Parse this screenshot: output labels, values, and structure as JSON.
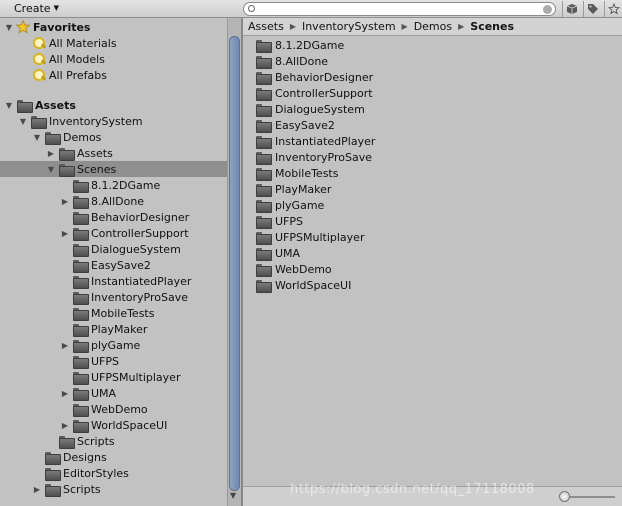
{
  "toolbar": {
    "create_label": "Create",
    "search_value": "",
    "icons": [
      "filter-by-type-icon",
      "filter-by-label-icon",
      "favorite-star-icon"
    ]
  },
  "favorites": {
    "label": "Favorites",
    "items": [
      {
        "label": "All Materials"
      },
      {
        "label": "All Models"
      },
      {
        "label": "All Prefabs"
      }
    ]
  },
  "tree": {
    "assets_label": "Assets",
    "rows": [
      {
        "label": "InventorySystem",
        "depth": 1,
        "arrow": "open"
      },
      {
        "label": "Demos",
        "depth": 2,
        "arrow": "open"
      },
      {
        "label": "Assets",
        "depth": 3,
        "arrow": "closed"
      },
      {
        "label": "Scenes",
        "depth": 3,
        "arrow": "open",
        "selected": true
      },
      {
        "label": "8.1.2DGame",
        "depth": 4,
        "arrow": "none"
      },
      {
        "label": "8.AllDone",
        "depth": 4,
        "arrow": "closed"
      },
      {
        "label": "BehaviorDesigner",
        "depth": 4,
        "arrow": "none"
      },
      {
        "label": "ControllerSupport",
        "depth": 4,
        "arrow": "closed"
      },
      {
        "label": "DialogueSystem",
        "depth": 4,
        "arrow": "none"
      },
      {
        "label": "EasySave2",
        "depth": 4,
        "arrow": "none"
      },
      {
        "label": "InstantiatedPlayer",
        "depth": 4,
        "arrow": "none"
      },
      {
        "label": "InventoryProSave",
        "depth": 4,
        "arrow": "none"
      },
      {
        "label": "MobileTests",
        "depth": 4,
        "arrow": "none"
      },
      {
        "label": "PlayMaker",
        "depth": 4,
        "arrow": "none"
      },
      {
        "label": "plyGame",
        "depth": 4,
        "arrow": "closed"
      },
      {
        "label": "UFPS",
        "depth": 4,
        "arrow": "none"
      },
      {
        "label": "UFPSMultiplayer",
        "depth": 4,
        "arrow": "none"
      },
      {
        "label": "UMA",
        "depth": 4,
        "arrow": "closed"
      },
      {
        "label": "WebDemo",
        "depth": 4,
        "arrow": "none"
      },
      {
        "label": "WorldSpaceUI",
        "depth": 4,
        "arrow": "closed"
      },
      {
        "label": "Scripts",
        "depth": 3,
        "arrow": "none"
      },
      {
        "label": "Designs",
        "depth": 2,
        "arrow": "none"
      },
      {
        "label": "EditorStyles",
        "depth": 2,
        "arrow": "none"
      },
      {
        "label": "Scripts",
        "depth": 2,
        "arrow": "closed"
      }
    ]
  },
  "breadcrumb": {
    "items": [
      "Assets",
      "InventorySystem",
      "Demos"
    ],
    "current": "Scenes"
  },
  "files": [
    "8.1.2DGame",
    "8.AllDone",
    "BehaviorDesigner",
    "ControllerSupport",
    "DialogueSystem",
    "EasySave2",
    "InstantiatedPlayer",
    "InventoryProSave",
    "MobileTests",
    "PlayMaker",
    "plyGame",
    "UFPS",
    "UFPSMultiplayer",
    "UMA",
    "WebDemo",
    "WorldSpaceUI"
  ],
  "watermark": "https://blog.csdn.net/qq_17118008",
  "colors": {
    "selection": "#8f8f8f",
    "panel_bg": "#c2c2c2",
    "scroll_thumb": "#7a93b8"
  }
}
